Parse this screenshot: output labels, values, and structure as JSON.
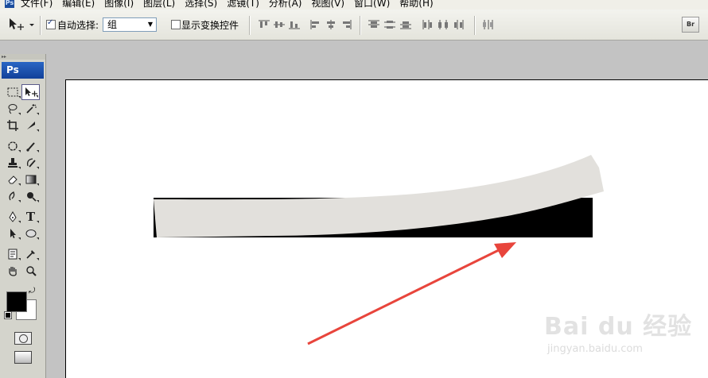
{
  "app": {
    "badge": "Ps"
  },
  "menu": [
    "文件(F)",
    "编辑(E)",
    "图像(I)",
    "图层(L)",
    "选择(S)",
    "滤镜(T)",
    "分析(A)",
    "视图(V)",
    "窗口(W)",
    "帮助(H)"
  ],
  "options": {
    "auto_select_label": "自动选择:",
    "auto_select_checked": true,
    "auto_select_value": "组",
    "show_transform_label": "显示变换控件",
    "show_transform_checked": false,
    "bridge_label": "Br"
  },
  "tools": {
    "panel_logo": "Ps",
    "type_tool_glyph": "T"
  },
  "colors": {
    "foreground": "#000000",
    "background": "#ffffff",
    "arrow": "#e8453c",
    "brush_stroke": "#e2e0dc"
  },
  "watermark": {
    "text": "Bai du 经验",
    "sub": "jingyan.baidu.com"
  }
}
